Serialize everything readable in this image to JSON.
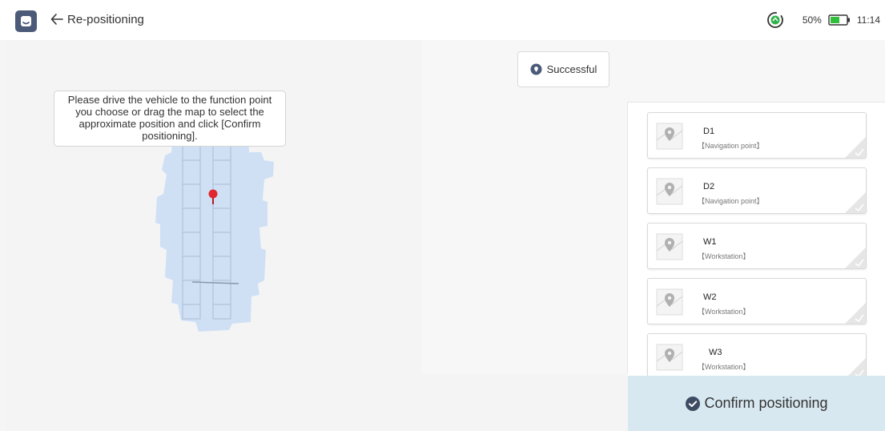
{
  "header": {
    "title": "Re-positioning",
    "battery_percent": "50%",
    "time": "11:14",
    "icons": {
      "home": "home-icon",
      "back": "back-arrow-icon",
      "sync": "sync-status-icon",
      "battery": "battery-icon"
    }
  },
  "map": {
    "instruction": "Please drive the vehicle to the function point you choose or drag the map to select the approximate position and click [Confirm positioning].",
    "marker_icon": "location-marker-icon"
  },
  "status": {
    "label": "Successful",
    "icon": "location-pin-icon"
  },
  "points": [
    {
      "name": "D1",
      "type": "【Navigation point】"
    },
    {
      "name": "D2",
      "type": "【Navigation point】"
    },
    {
      "name": "W1",
      "type": "【Workstation】"
    },
    {
      "name": "W2",
      "type": "【Workstation】"
    },
    {
      "name": "W3",
      "type": "【Workstation】"
    }
  ],
  "confirm": {
    "label": "Confirm positioning",
    "icon": "check-circle-icon"
  },
  "colors": {
    "home_button": "#4a5a78",
    "map_fill": "#cfe0f5",
    "marker": "#e0282e",
    "sync_green": "#2fb34a",
    "battery_green": "#2fbf3a",
    "confirm_bg": "#d8e8f1",
    "success_icon": "#4a5a78"
  }
}
